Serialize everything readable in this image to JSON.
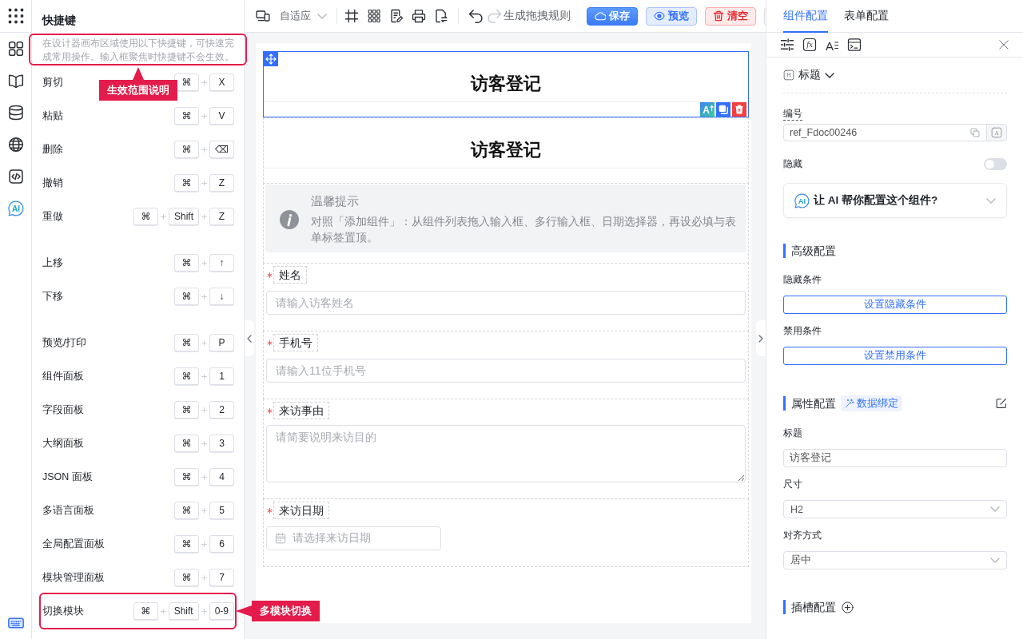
{
  "rail": {
    "items": [
      {
        "kind": "components",
        "selected": false
      },
      {
        "kind": "book",
        "selected": false
      },
      {
        "kind": "database",
        "selected": false
      },
      {
        "kind": "globe",
        "selected": false
      },
      {
        "kind": "code",
        "selected": false
      },
      {
        "kind": "ai",
        "glyph": "AI",
        "selected": false
      }
    ],
    "bottom_items": [
      {
        "kind": "keyboard",
        "selected": true
      }
    ]
  },
  "shortcuts": {
    "title": "快捷键",
    "description": "在设计器画布区域使用以下快捷键，可快速完成常用操作。输入框聚焦时快捷键不会生效。",
    "description_callout": "生效范围说明",
    "groups": [
      {
        "rows": [
          {
            "action": "剪切",
            "keys": [
              "⌘",
              "X"
            ]
          },
          {
            "action": "粘贴",
            "keys": [
              "⌘",
              "V"
            ]
          },
          {
            "action": "删除",
            "keys": [
              "⌘",
              "⌫"
            ]
          },
          {
            "action": "撤销",
            "keys": [
              "⌘",
              "Z"
            ]
          },
          {
            "action": "重做",
            "keys": [
              "⌘",
              "Shift",
              "Z"
            ]
          }
        ]
      },
      {
        "rows": [
          {
            "action": "上移",
            "keys": [
              "⌘",
              "↑"
            ]
          },
          {
            "action": "下移",
            "keys": [
              "⌘",
              "↓"
            ]
          }
        ]
      },
      {
        "rows": [
          {
            "action": "预览/打印",
            "keys": [
              "⌘",
              "P"
            ]
          },
          {
            "action": "组件面板",
            "keys": [
              "⌘",
              "1"
            ]
          },
          {
            "action": "字段面板",
            "keys": [
              "⌘",
              "2"
            ]
          },
          {
            "action": "大纲面板",
            "keys": [
              "⌘",
              "3"
            ]
          },
          {
            "action": "JSON 面板",
            "keys": [
              "⌘",
              "4"
            ]
          },
          {
            "action": "多语言面板",
            "keys": [
              "⌘",
              "5"
            ]
          },
          {
            "action": "全局配置面板",
            "keys": [
              "⌘",
              "6"
            ]
          },
          {
            "action": "模块管理面板",
            "keys": [
              "⌘",
              "7"
            ]
          },
          {
            "action": "切换模块",
            "keys": [
              "⌘",
              "Shift",
              "0-9"
            ],
            "callout": "多模块切换"
          }
        ]
      }
    ]
  },
  "toolbar": {
    "viewport": "自适应",
    "history": [
      {
        "kind": "undo",
        "disabled": false
      },
      {
        "kind": "redo",
        "disabled": true
      }
    ],
    "rules_button": "生成拖拽规则",
    "actions": [
      {
        "kind": "primary",
        "label": "保存"
      },
      {
        "kind": "info",
        "label": "预览"
      },
      {
        "kind": "danger",
        "label": "清空"
      }
    ]
  },
  "canvas": {
    "blocks": [
      {
        "kind": "title",
        "text": "访客登记",
        "selected": true,
        "actions": [
          {
            "kind": "ai",
            "glyph": "A"
          },
          {
            "kind": "copy"
          },
          {
            "kind": "delete"
          }
        ]
      },
      {
        "kind": "title",
        "text": "访客登记",
        "selected": false
      },
      {
        "kind": "alert",
        "title": "温馨提示",
        "text": "对照「添加组件」：从组件列表拖入输入框、多行输入框、日期选择器，再设必填与表单标签置顶。"
      },
      {
        "kind": "input",
        "label": "姓名",
        "required": true,
        "placeholder": "请输入访客姓名"
      },
      {
        "kind": "input",
        "label": "手机号",
        "required": true,
        "placeholder": "请输入11位手机号"
      },
      {
        "kind": "textarea",
        "label": "来访事由",
        "required": true,
        "placeholder": "请简要说明来访目的"
      },
      {
        "kind": "date",
        "label": "来访日期",
        "required": true,
        "placeholder": "请选择来访日期"
      }
    ]
  },
  "inspector": {
    "tabs": [
      {
        "label": "组件配置",
        "selected": true
      },
      {
        "label": "表单配置",
        "selected": false
      }
    ],
    "tools": [
      {
        "kind": "sliders"
      },
      {
        "kind": "formula",
        "glyph": "fx"
      },
      {
        "kind": "typography",
        "glyph": "A"
      },
      {
        "kind": "console"
      }
    ],
    "component": {
      "glyph": "H",
      "label": "标题"
    },
    "id_field": {
      "label": "编号",
      "value": "ref_Fdoc00246",
      "addon_glyph": "A"
    },
    "hidden": {
      "label": "隐藏",
      "on": false
    },
    "ai_prompt": {
      "glyph": "AI",
      "text": "让 AI 帮你配置这个组件?"
    },
    "sections": [
      {
        "kind": "advanced",
        "title": "高级配置",
        "fields": [
          {
            "kind": "button",
            "label": "隐藏条件",
            "button": "设置隐藏条件"
          },
          {
            "kind": "button",
            "label": "禁用条件",
            "button": "设置禁用条件"
          }
        ]
      },
      {
        "kind": "properties",
        "title": "属性配置",
        "tag": "数据绑定",
        "fields": [
          {
            "kind": "input",
            "label": "标题",
            "value": "访客登记"
          },
          {
            "kind": "select",
            "label": "尺寸",
            "value": "H2"
          },
          {
            "kind": "select",
            "label": "对齐方式",
            "value": "居中"
          }
        ]
      },
      {
        "kind": "slots",
        "title": "插槽配置"
      }
    ]
  }
}
